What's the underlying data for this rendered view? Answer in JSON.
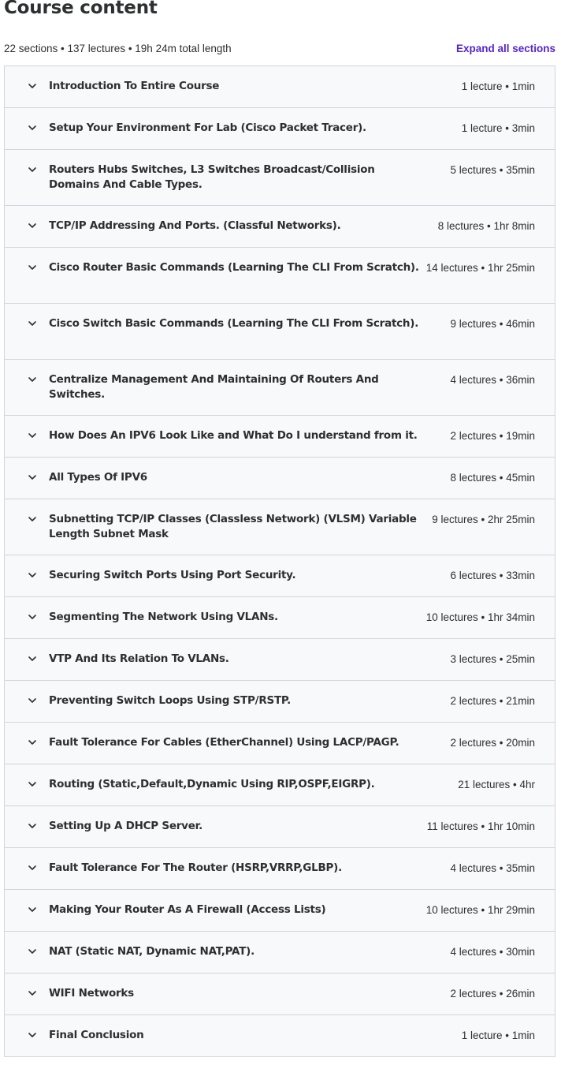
{
  "header": {
    "title": "Course content",
    "summary": "22 sections • 137 lectures • 19h 24m total length",
    "expand_all_label": "Expand all sections"
  },
  "sections": [
    {
      "title": "Introduction To Entire Course",
      "meta": "1 lecture • 1min"
    },
    {
      "title": "Setup Your Environment For Lab (Cisco Packet Tracer).",
      "meta": "1 lecture • 3min"
    },
    {
      "title": "Routers Hubs Switches, L3 Switches Broadcast/Collision Domains And Cable Types.",
      "meta": "5 lectures • 35min"
    },
    {
      "title": "TCP/IP Addressing And Ports. (Classful Networks).",
      "meta": "8 lectures • 1hr 8min"
    },
    {
      "title": "Cisco Router Basic Commands (Learning The CLI From Scratch).",
      "meta": "14 lectures • 1hr 25min"
    },
    {
      "title": "Cisco Switch Basic Commands (Learning The CLI From Scratch).",
      "meta": "9 lectures • 46min"
    },
    {
      "title": "Centralize Management And Maintaining Of Routers And Switches.",
      "meta": "4 lectures • 36min"
    },
    {
      "title": "How Does An IPV6 Look Like and What Do I understand from it.",
      "meta": "2 lectures • 19min"
    },
    {
      "title": "All Types Of IPV6",
      "meta": "8 lectures • 45min"
    },
    {
      "title": "Subnetting TCP/IP Classes (Classless Network) (VLSM) Variable Length Subnet Mask",
      "meta": "9 lectures • 2hr 25min"
    },
    {
      "title": "Securing Switch Ports Using Port Security.",
      "meta": "6 lectures • 33min"
    },
    {
      "title": "Segmenting The Network Using VLANs.",
      "meta": "10 lectures • 1hr 34min"
    },
    {
      "title": "VTP And Its Relation To VLANs.",
      "meta": "3 lectures • 25min"
    },
    {
      "title": "Preventing Switch Loops Using STP/RSTP.",
      "meta": "2 lectures • 21min"
    },
    {
      "title": "Fault Tolerance For Cables (EtherChannel) Using LACP/PAGP.",
      "meta": "2 lectures • 20min"
    },
    {
      "title": "Routing (Static,Default,Dynamic Using RIP,OSPF,EIGRP).",
      "meta": "21 lectures • 4hr"
    },
    {
      "title": "Setting Up A DHCP Server.",
      "meta": "11 lectures • 1hr 10min"
    },
    {
      "title": "Fault Tolerance For The Router (HSRP,VRRP,GLBP).",
      "meta": "4 lectures • 35min"
    },
    {
      "title": "Making Your Router As A Firewall (Access Lists)",
      "meta": "10 lectures • 1hr 29min"
    },
    {
      "title": "NAT (Static NAT, Dynamic NAT,PAT).",
      "meta": "4 lectures • 30min"
    },
    {
      "title": "WIFI Networks",
      "meta": "2 lectures • 26min"
    },
    {
      "title": "Final Conclusion",
      "meta": "1 lecture • 1min"
    }
  ],
  "icons": {
    "section_toggle": "chevron-down-icon"
  },
  "colors": {
    "accent": "#5624d0",
    "text": "#2d2f31",
    "row_background": "#f7f9fa",
    "border": "#d1d7dc"
  }
}
